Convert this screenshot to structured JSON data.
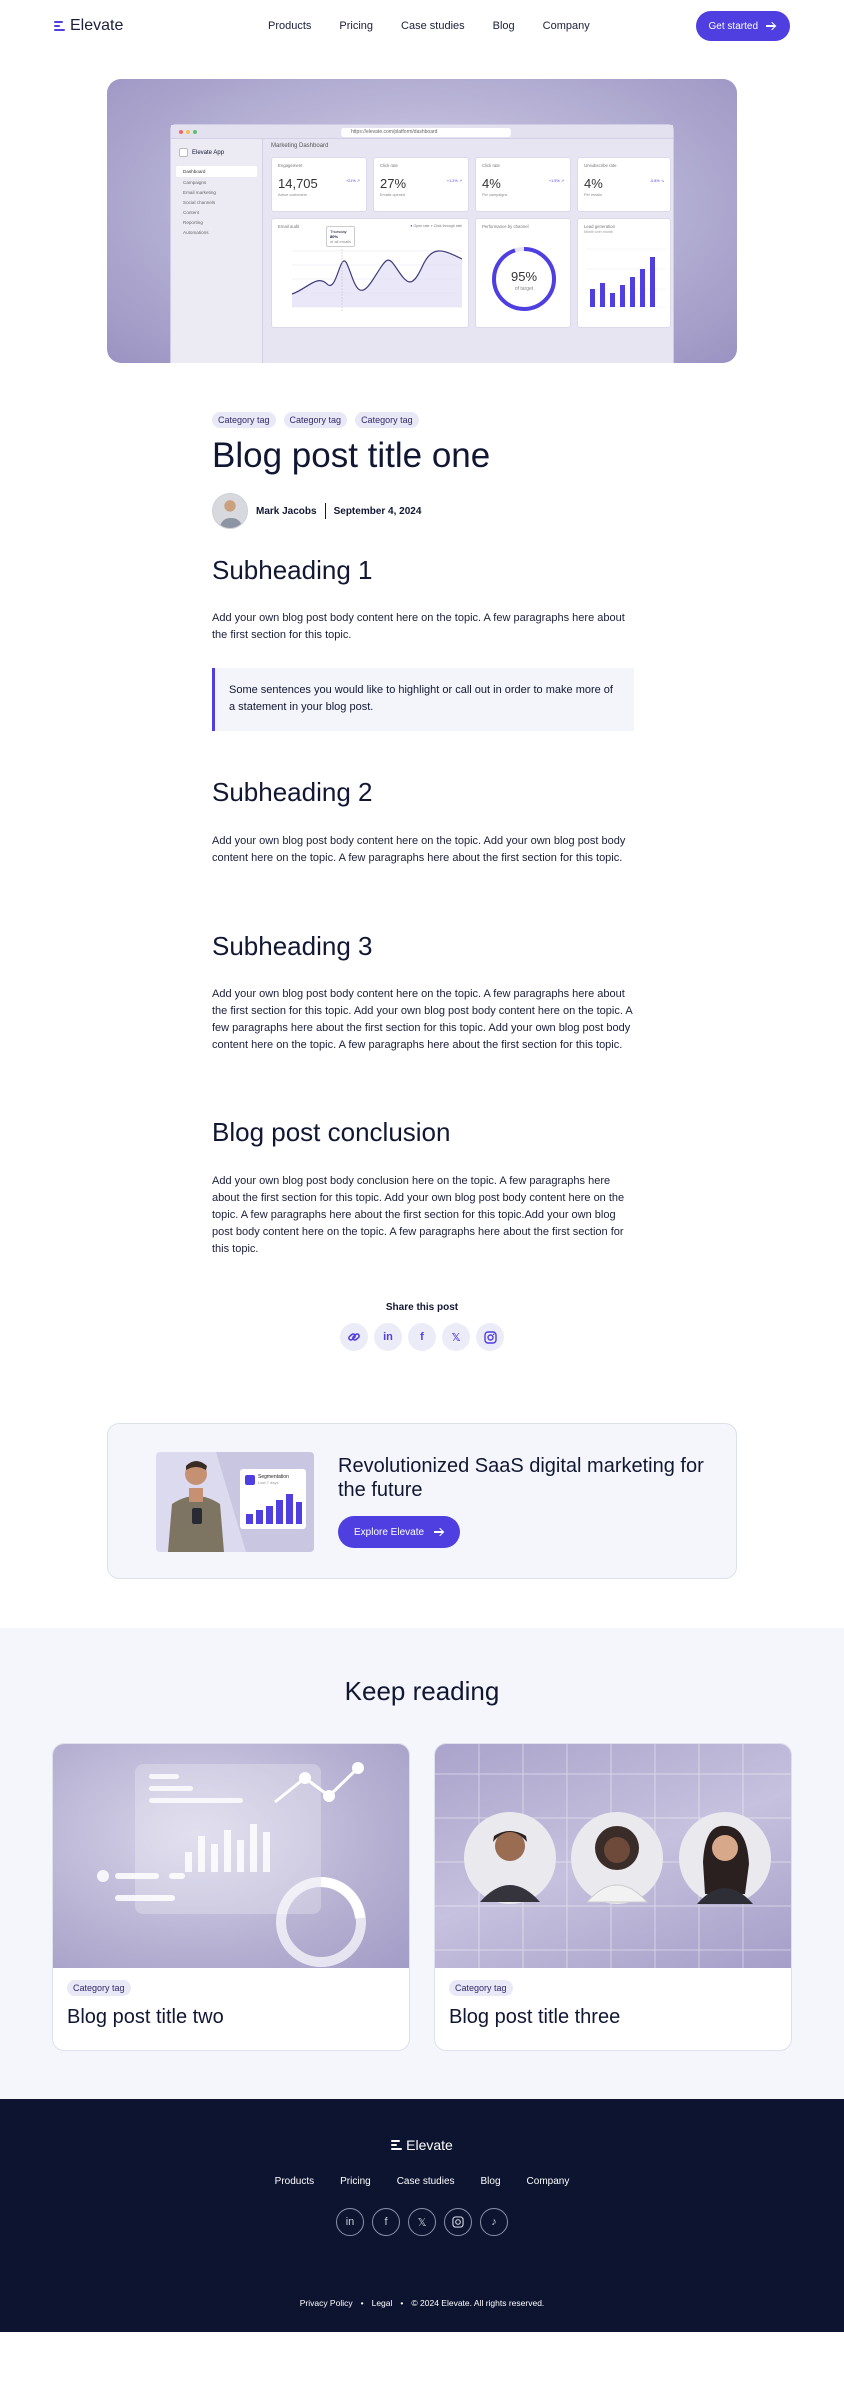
{
  "brand": {
    "name": "Elevate",
    "accent": "#4f3fe0"
  },
  "nav": {
    "items": [
      "Products",
      "Pricing",
      "Case studies",
      "Blog",
      "Company"
    ],
    "cta": "Get started"
  },
  "hero_dashboard": {
    "url": "https://elevate.com/platform/dashboard",
    "app_name": "Elevate App",
    "title": "Marketing Dashboard",
    "sidebar": [
      "Dashboard",
      "Campaigns",
      "Email marketing",
      "Social channels",
      "Content",
      "Reporting",
      "Automations"
    ],
    "kpis": [
      {
        "label": "Engagement",
        "value": "14,705",
        "delta": "+21% ↗",
        "note": "Active customers"
      },
      {
        "label": "Click rate",
        "value": "27%",
        "delta": "+1.2% ↗",
        "note": "Emails opened"
      },
      {
        "label": "Click rate",
        "value": "4%",
        "delta": "+1.5% ↗",
        "note": "Per campaigns"
      },
      {
        "label": "Unsubscribe rate",
        "value": "4%",
        "delta": "-0.8% ↘",
        "note": "Per emails"
      }
    ],
    "email_card": {
      "title": "Email audit",
      "legend_a": "Open rate",
      "legend_b": "Click-through rate",
      "tooltip_title": "Thursday",
      "tooltip_value": "80%",
      "tooltip_note": "of all emails"
    },
    "performance": {
      "title": "Performance by channel",
      "value": "95%",
      "note": "of target"
    },
    "leads": {
      "title": "Lead generation",
      "note": "Month over month"
    }
  },
  "article": {
    "tags": [
      "Category tag",
      "Category tag",
      "Category tag"
    ],
    "title": "Blog post title one",
    "author": "Mark Jacobs",
    "date": "September 4, 2024",
    "sections": [
      {
        "heading": "Subheading 1",
        "body": "Add your own blog post body content here on the topic. A few paragraphs here about the first section for this topic."
      },
      {
        "heading": "Subheading 2",
        "body": "Add your own blog post body content here on the topic. Add your own blog post body content here on the topic. A few paragraphs here about the first section for this topic."
      },
      {
        "heading": "Subheading 3",
        "body": "Add your own blog post body content here on the topic. A few paragraphs here about the first section for this topic. Add your own blog post body content here on the topic. A few paragraphs here about the first section for this topic. Add your own blog post body content here on the topic. A few paragraphs here about the first section for this topic."
      },
      {
        "heading": "Blog post conclusion",
        "body": "Add your own blog post body conclusion here on the topic. A few paragraphs here about the first section for this topic. Add your own blog post body content here on the topic. A few paragraphs here about the first section for this topic.Add your own blog post body content here on the topic. A few paragraphs here about the first section for this topic."
      }
    ],
    "quote": "Some sentences you would like to highlight or call out in order to make more of a statement in your blog post."
  },
  "share": {
    "label": "Share this post",
    "icons": [
      "link-icon",
      "linkedin-icon",
      "facebook-icon",
      "x-icon",
      "instagram-icon"
    ]
  },
  "promo": {
    "title": "Revolutionized SaaS digital marketing for the future",
    "button": "Explore Elevate",
    "card_label": "Segmentation",
    "card_note": "Last 7 days"
  },
  "keep_reading": {
    "heading": "Keep reading",
    "posts": [
      {
        "tag": "Category tag",
        "title": "Blog post title two"
      },
      {
        "tag": "Category tag",
        "title": "Blog post title three"
      }
    ]
  },
  "footer": {
    "nav": [
      "Products",
      "Pricing",
      "Case studies",
      "Blog",
      "Company"
    ],
    "social": [
      "linkedin-icon",
      "facebook-icon",
      "x-icon",
      "instagram-icon",
      "tiktok-icon"
    ],
    "legal": [
      "Privacy Policy",
      "Legal",
      "© 2024 Elevate. All rights reserved."
    ]
  }
}
